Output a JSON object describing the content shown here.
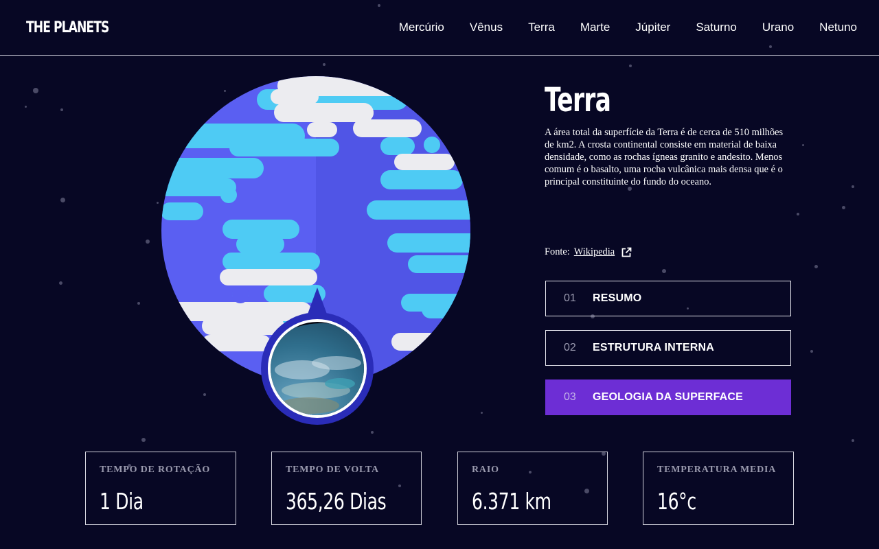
{
  "header": {
    "logo": "THE PLANETS",
    "nav": [
      "Mercúrio",
      "Vênus",
      "Terra",
      "Marte",
      "Júpiter",
      "Saturno",
      "Urano",
      "Netuno"
    ]
  },
  "planet": {
    "name": "Terra",
    "description": "A área total da superfície da Terra é de cerca de 510 milhões de km2. A crosta continental consiste em material de baixa densidade, como as rochas ígneas granito e andesito. Menos comum é o basalto, uma rocha vulcânica mais densa que é o principal constituinte do fundo do oceano.",
    "source_label": "Fonte:",
    "source_link": "Wikipedia"
  },
  "tabs": [
    {
      "num": "01",
      "label": "RESUMO"
    },
    {
      "num": "02",
      "label": "ESTRUTURA INTERNA"
    },
    {
      "num": "03",
      "label": "GEOLOGIA DA SUPERFACE"
    }
  ],
  "active_tab": 2,
  "stats": [
    {
      "label": "TEMPO DE ROTAÇÃO",
      "value": "1 Dia"
    },
    {
      "label": "TEMPO DE VOLTA",
      "value": "365,26 Dias"
    },
    {
      "label": "RAIO",
      "value": "6.371 km"
    },
    {
      "label": "TEMPERATURA MEDIA",
      "value": "16°c"
    }
  ],
  "colors": {
    "background": "#070724",
    "accent": "#6d2ed5",
    "planet_base": "#5a5ff2",
    "planet_light": "#4ecbf4",
    "cloud": "#ececf0",
    "badge": "#2a2cb8"
  },
  "icons": {
    "external_link": "external-link-icon"
  }
}
